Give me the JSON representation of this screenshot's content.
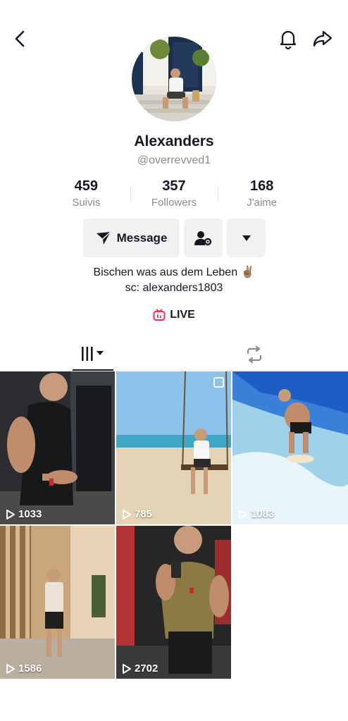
{
  "header": {
    "back_icon": "chevron-left-icon",
    "bell_icon": "bell-icon",
    "share_icon": "share-arrow-icon"
  },
  "profile": {
    "name": "Alexanders",
    "handle": "@overrevved1",
    "stats": [
      {
        "value": "459",
        "label": "Suivis"
      },
      {
        "value": "357",
        "label": "Followers"
      },
      {
        "value": "168",
        "label": "J'aime"
      }
    ],
    "buttons": {
      "message": "Message"
    },
    "bio_line1": "Bischen was aus dem Leben ✌🏽",
    "bio_line2": "sc: alexanders1803",
    "live_label": "LIVE"
  },
  "tabs": {
    "videos_icon": "grid-bars-icon",
    "repost_icon": "repost-icon"
  },
  "videos": [
    {
      "views": "1033",
      "scene": "gym"
    },
    {
      "views": "785",
      "scene": "beach-swing"
    },
    {
      "views": "1083",
      "scene": "surf"
    },
    {
      "views": "1586",
      "scene": "street"
    },
    {
      "views": "2702",
      "scene": "mirror-selfie"
    }
  ],
  "colors": {
    "accent_live": "#fe2c55",
    "text_primary": "#161823",
    "text_secondary": "#8a8b91",
    "button_bg": "#f1f1f2"
  }
}
